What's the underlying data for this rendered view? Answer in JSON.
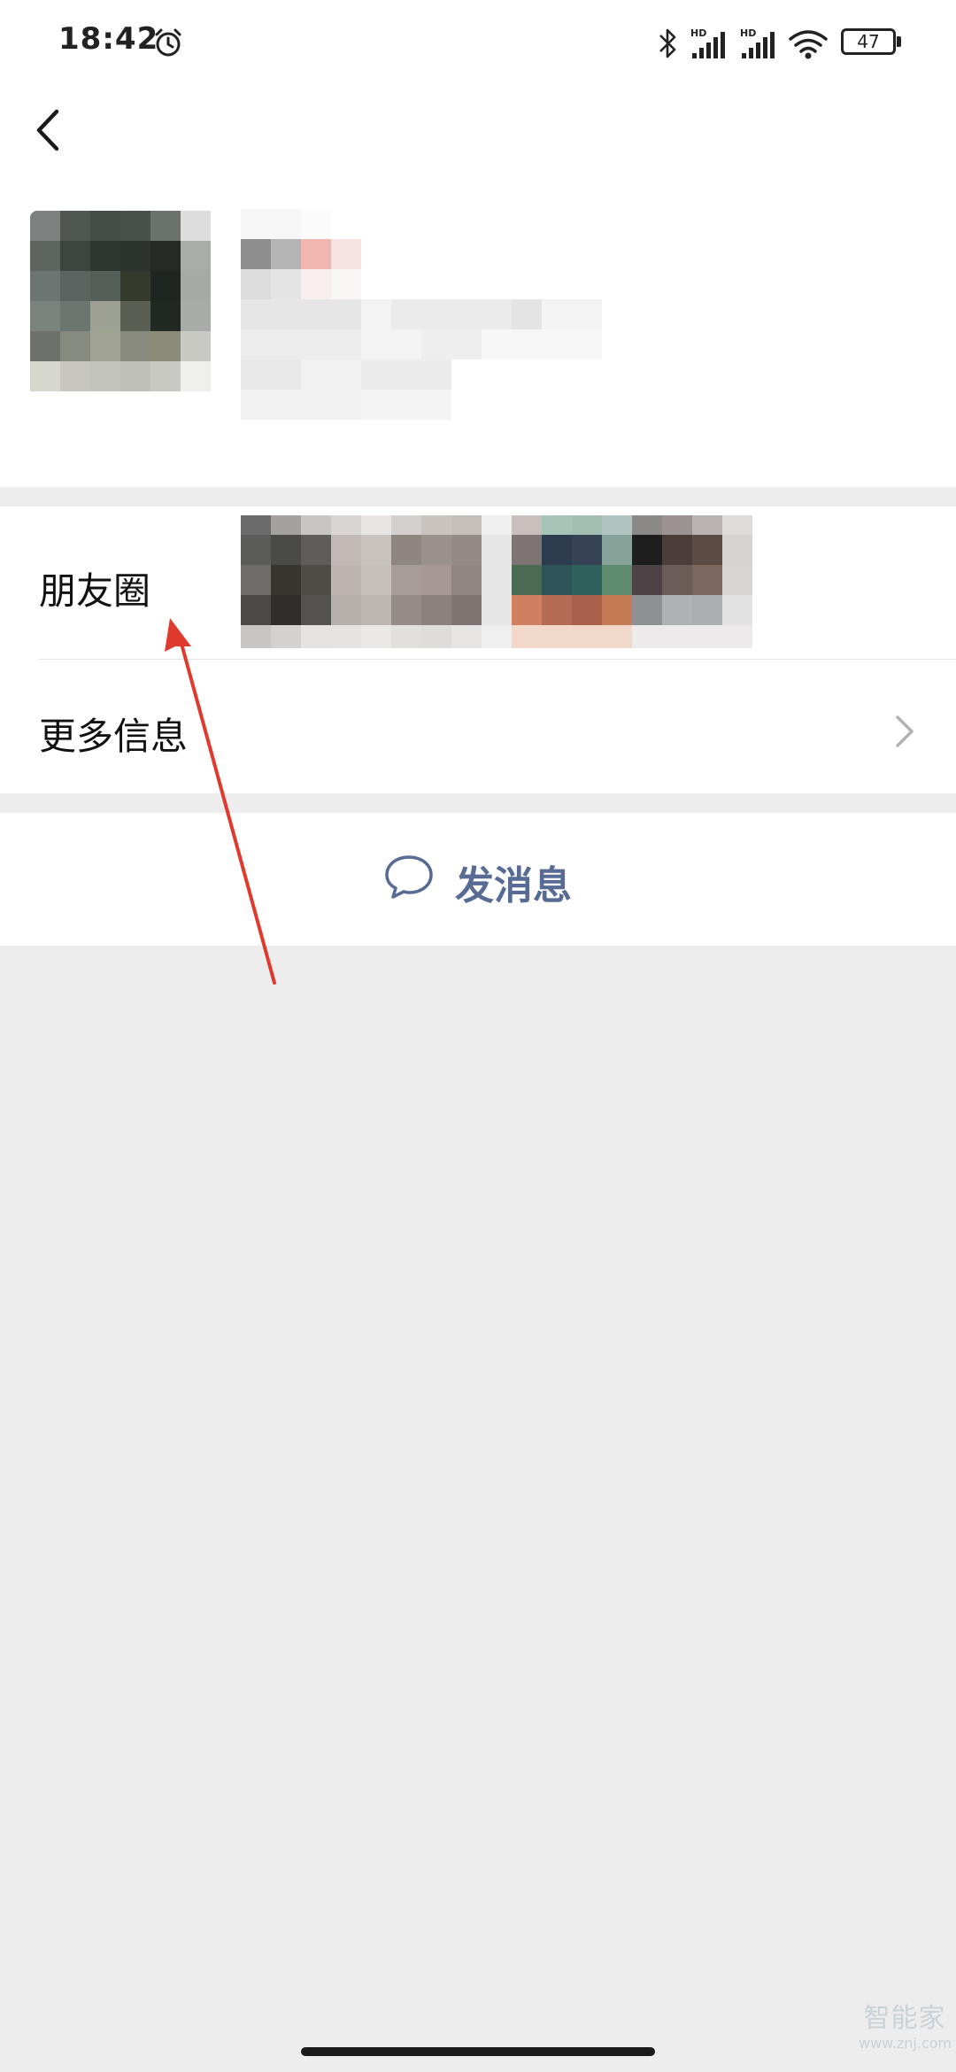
{
  "status_bar": {
    "time": "18:42",
    "battery": "47",
    "network_label": "HD"
  },
  "list": {
    "moments_label": "朋友圈",
    "more_info_label": "更多信息"
  },
  "actions": {
    "send_message_label": "发消息"
  },
  "watermark": {
    "main": "智能家",
    "sub": "www.znj.com"
  },
  "colors": {
    "accent_link": "#576b95",
    "background": "#ededed",
    "annotation_arrow": "#e03a2f"
  },
  "icons": {
    "back": "back-chevron-icon",
    "alarm": "alarm-clock-icon",
    "bluetooth": "bluetooth-icon",
    "wifi": "wifi-icon",
    "chat": "chat-bubble-icon",
    "chevron": "chevron-right-icon"
  }
}
